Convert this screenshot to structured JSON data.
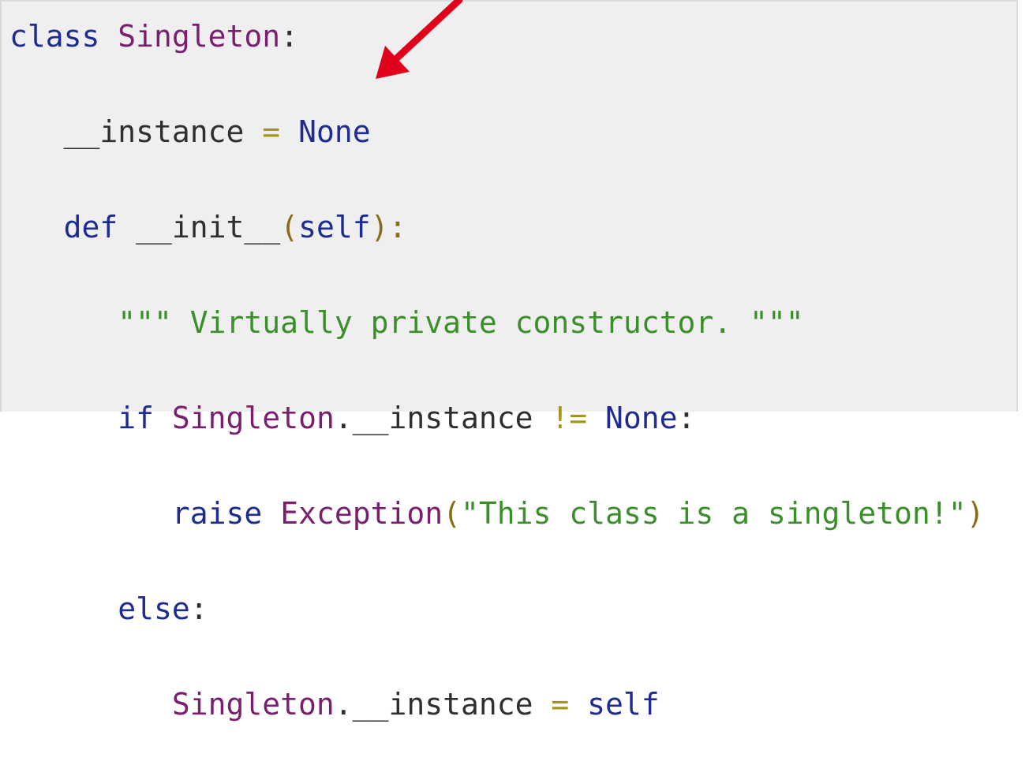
{
  "code_lines": [
    {
      "indent": "",
      "tokens": [
        {
          "text": "class ",
          "kind": "kw"
        },
        {
          "text": "Singleton",
          "kind": "cls"
        },
        {
          "text": ":",
          "kind": "plain"
        }
      ]
    },
    {
      "indent": "   ",
      "tokens": [
        {
          "text": "__instance",
          "kind": "plain"
        },
        {
          "text": " = ",
          "kind": "op"
        },
        {
          "text": "None",
          "kind": "kw"
        }
      ]
    },
    {
      "indent": "   ",
      "tokens": [
        {
          "text": "def ",
          "kind": "kw"
        },
        {
          "text": "__init__",
          "kind": "plain"
        },
        {
          "text": "(",
          "kind": "paren"
        },
        {
          "text": "self",
          "kind": "kw"
        },
        {
          "text": "):",
          "kind": "paren"
        }
      ]
    },
    {
      "indent": "      ",
      "tokens": [
        {
          "text": "\"\"\" Virtually private constructor. \"\"\"",
          "kind": "str"
        }
      ]
    },
    {
      "indent": "      ",
      "tokens": [
        {
          "text": "if ",
          "kind": "kw"
        },
        {
          "text": "Singleton",
          "kind": "cls"
        },
        {
          "text": ".",
          "kind": "plain"
        },
        {
          "text": "__instance",
          "kind": "plain"
        },
        {
          "text": " != ",
          "kind": "op"
        },
        {
          "text": "None",
          "kind": "kw"
        },
        {
          "text": ":",
          "kind": "plain"
        }
      ]
    },
    {
      "indent": "         ",
      "tokens": [
        {
          "text": "raise ",
          "kind": "kw"
        },
        {
          "text": "Exception",
          "kind": "cls"
        },
        {
          "text": "(",
          "kind": "paren"
        },
        {
          "text": "\"This class is a singleton!\"",
          "kind": "str"
        },
        {
          "text": ")",
          "kind": "paren"
        }
      ]
    },
    {
      "indent": "      ",
      "tokens": [
        {
          "text": "else",
          "kind": "kw"
        },
        {
          "text": ":",
          "kind": "plain"
        }
      ]
    },
    {
      "indent": "         ",
      "tokens": [
        {
          "text": "Singleton",
          "kind": "cls"
        },
        {
          "text": ".",
          "kind": "plain"
        },
        {
          "text": "__instance",
          "kind": "plain"
        },
        {
          "text": " = ",
          "kind": "op"
        },
        {
          "text": "self",
          "kind": "kw"
        }
      ]
    }
  ],
  "colors": {
    "keyword": "#1f2c8f",
    "class_name": "#7a1f70",
    "string": "#3a8f2a",
    "operator": "#a3961a",
    "background": "#efefef",
    "arrow": "#e0001b"
  },
  "annotation": {
    "icon": "red-arrow-icon",
    "points_to": "None"
  }
}
